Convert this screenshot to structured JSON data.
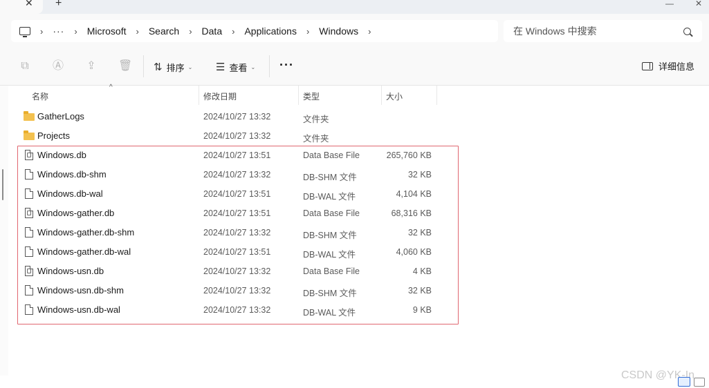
{
  "tabs": {
    "close_glyph": "✕",
    "new_glyph": "+",
    "close_window_glyph": "✕"
  },
  "breadcrumb": {
    "overflow": "···",
    "items": [
      "Microsoft",
      "Search",
      "Data",
      "Applications",
      "Windows"
    ]
  },
  "search": {
    "placeholder": "在 Windows 中搜索"
  },
  "toolbar": {
    "sort_label": "排序",
    "view_label": "查看",
    "more_label": "···",
    "details_label": "详细信息"
  },
  "columns": {
    "name": "名称",
    "modified": "修改日期",
    "type": "类型",
    "size": "大小"
  },
  "files": [
    {
      "name": "GatherLogs",
      "modified": "2024/10/27 13:32",
      "type": "文件夹",
      "size": "",
      "icon": "folder-icon"
    },
    {
      "name": "Projects",
      "modified": "2024/10/27 13:32",
      "type": "文件夹",
      "size": "",
      "icon": "folder-icon"
    },
    {
      "name": "Windows.db",
      "modified": "2024/10/27 13:51",
      "type": "Data Base File",
      "size": "265,760 KB",
      "icon": "db-file-icon"
    },
    {
      "name": "Windows.db-shm",
      "modified": "2024/10/27 13:32",
      "type": "DB-SHM 文件",
      "size": "32 KB",
      "icon": "file-icon"
    },
    {
      "name": "Windows.db-wal",
      "modified": "2024/10/27 13:51",
      "type": "DB-WAL 文件",
      "size": "4,104 KB",
      "icon": "file-icon"
    },
    {
      "name": "Windows-gather.db",
      "modified": "2024/10/27 13:51",
      "type": "Data Base File",
      "size": "68,316 KB",
      "icon": "db-file-icon"
    },
    {
      "name": "Windows-gather.db-shm",
      "modified": "2024/10/27 13:32",
      "type": "DB-SHM 文件",
      "size": "32 KB",
      "icon": "file-icon"
    },
    {
      "name": "Windows-gather.db-wal",
      "modified": "2024/10/27 13:51",
      "type": "DB-WAL 文件",
      "size": "4,060 KB",
      "icon": "file-icon"
    },
    {
      "name": "Windows-usn.db",
      "modified": "2024/10/27 13:32",
      "type": "Data Base File",
      "size": "4 KB",
      "icon": "db-file-icon"
    },
    {
      "name": "Windows-usn.db-shm",
      "modified": "2024/10/27 13:32",
      "type": "DB-SHM 文件",
      "size": "32 KB",
      "icon": "file-icon"
    },
    {
      "name": "Windows-usn.db-wal",
      "modified": "2024/10/27 13:32",
      "type": "DB-WAL 文件",
      "size": "9 KB",
      "icon": "file-icon"
    }
  ],
  "highlight_color": "#e0666f",
  "folder_color": "#f3c14f",
  "watermark": "CSDN @YK-In"
}
